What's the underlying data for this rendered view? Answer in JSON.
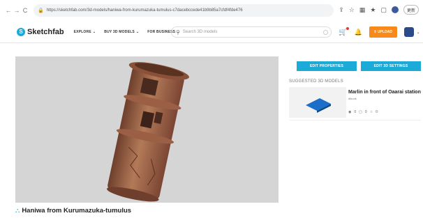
{
  "browser": {
    "back": "←",
    "forward": "→",
    "reload": "C",
    "url": "https://sketchfab.com/3d-models/haniwa-from-kurumazuka-tumulus-c7dacebccede41b9b85a7cfdf4fde476",
    "profile_label": "更新"
  },
  "header": {
    "logo_text": "Sketchfab",
    "nav": [
      {
        "label": "EXPLORE"
      },
      {
        "label": "BUY 3D MODELS"
      },
      {
        "label": "FOR BUSINESS"
      }
    ],
    "search_placeholder": "Search 3D models",
    "upload_label": "UPLOAD"
  },
  "sidebar": {
    "edit_properties_label": "EDIT PROPERTIES",
    "edit_settings_label": "EDIT 3D SETTINGS",
    "suggested_label": "SUGGESTED 3D MODELS",
    "suggested": [
      {
        "title": "Marlin in front of Oaarai station",
        "author": "dibunk",
        "views": "0",
        "comments": "0",
        "likes": "0"
      }
    ]
  },
  "model": {
    "title": "Haniwa from Kurumazuka-tumulus"
  },
  "colors": {
    "accent": "#1caad9",
    "upload": "#f8891c",
    "viewer_bg": "#d5d5d5",
    "clay": "#a0664a"
  }
}
